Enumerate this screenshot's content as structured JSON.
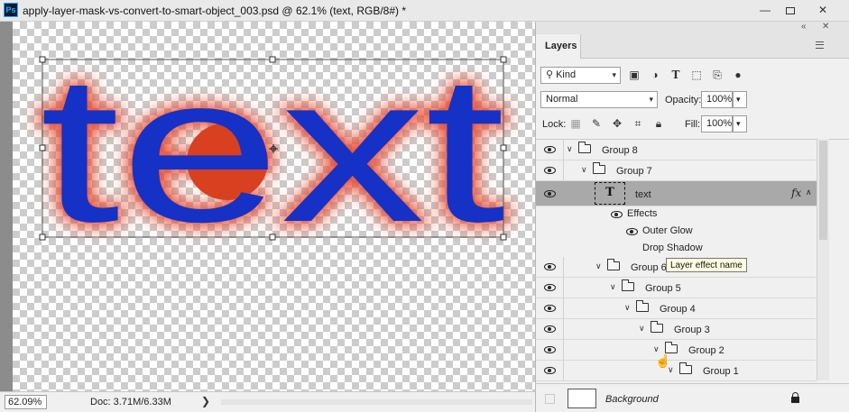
{
  "window": {
    "app_icon": "Ps",
    "title": "apply-layer-mask-vs-convert-to-smart-object_003.psd @ 62.1% (text, RGB/8#) *",
    "controls": [
      "minimize-icon",
      "maximize-icon",
      "close-icon"
    ]
  },
  "canvas": {
    "text": "text",
    "text_color": "#1531c6",
    "glow_color": "#e8442a",
    "inner_fill_color": "#d9401f"
  },
  "status": {
    "zoom": "62.09%",
    "doc": "Doc: 3.71M/6.33M",
    "arrow": "❯"
  },
  "panel": {
    "tab": "Layers",
    "filter": {
      "label": "Kind",
      "icons": [
        "image-filter-icon",
        "adjustment-filter-icon",
        "type-filter-icon",
        "shape-filter-icon",
        "smartobject-filter-icon",
        "filter-toggle-icon"
      ]
    },
    "blend_mode": "Normal",
    "opacity_label": "Opacity:",
    "opacity": "100%",
    "lock_label": "Lock:",
    "fill_label": "Fill:",
    "fill": "100%",
    "layers": [
      {
        "name": "Group 8",
        "type": "group",
        "expanded": true,
        "depth": 0
      },
      {
        "name": "Group 7",
        "type": "group",
        "expanded": true,
        "depth": 1
      },
      {
        "name": "text",
        "type": "text",
        "selected": true,
        "fx": "fx",
        "effects_label": "Effects",
        "effects": [
          "Outer Glow",
          "Drop Shadow"
        ]
      },
      {
        "name": "Group 6",
        "type": "group",
        "expanded": true,
        "depth": 2
      },
      {
        "name": "Group 5",
        "type": "group",
        "expanded": true,
        "depth": 3
      },
      {
        "name": "Group 4",
        "type": "group",
        "expanded": true,
        "depth": 4
      },
      {
        "name": "Group 3",
        "type": "group",
        "expanded": true,
        "depth": 5
      },
      {
        "name": "Group 2",
        "type": "group",
        "expanded": true,
        "depth": 6
      },
      {
        "name": "Group 1",
        "type": "group",
        "expanded": true,
        "depth": 7
      }
    ],
    "tooltip": "Layer effect name",
    "background": {
      "name": "Background",
      "locked": true
    }
  }
}
